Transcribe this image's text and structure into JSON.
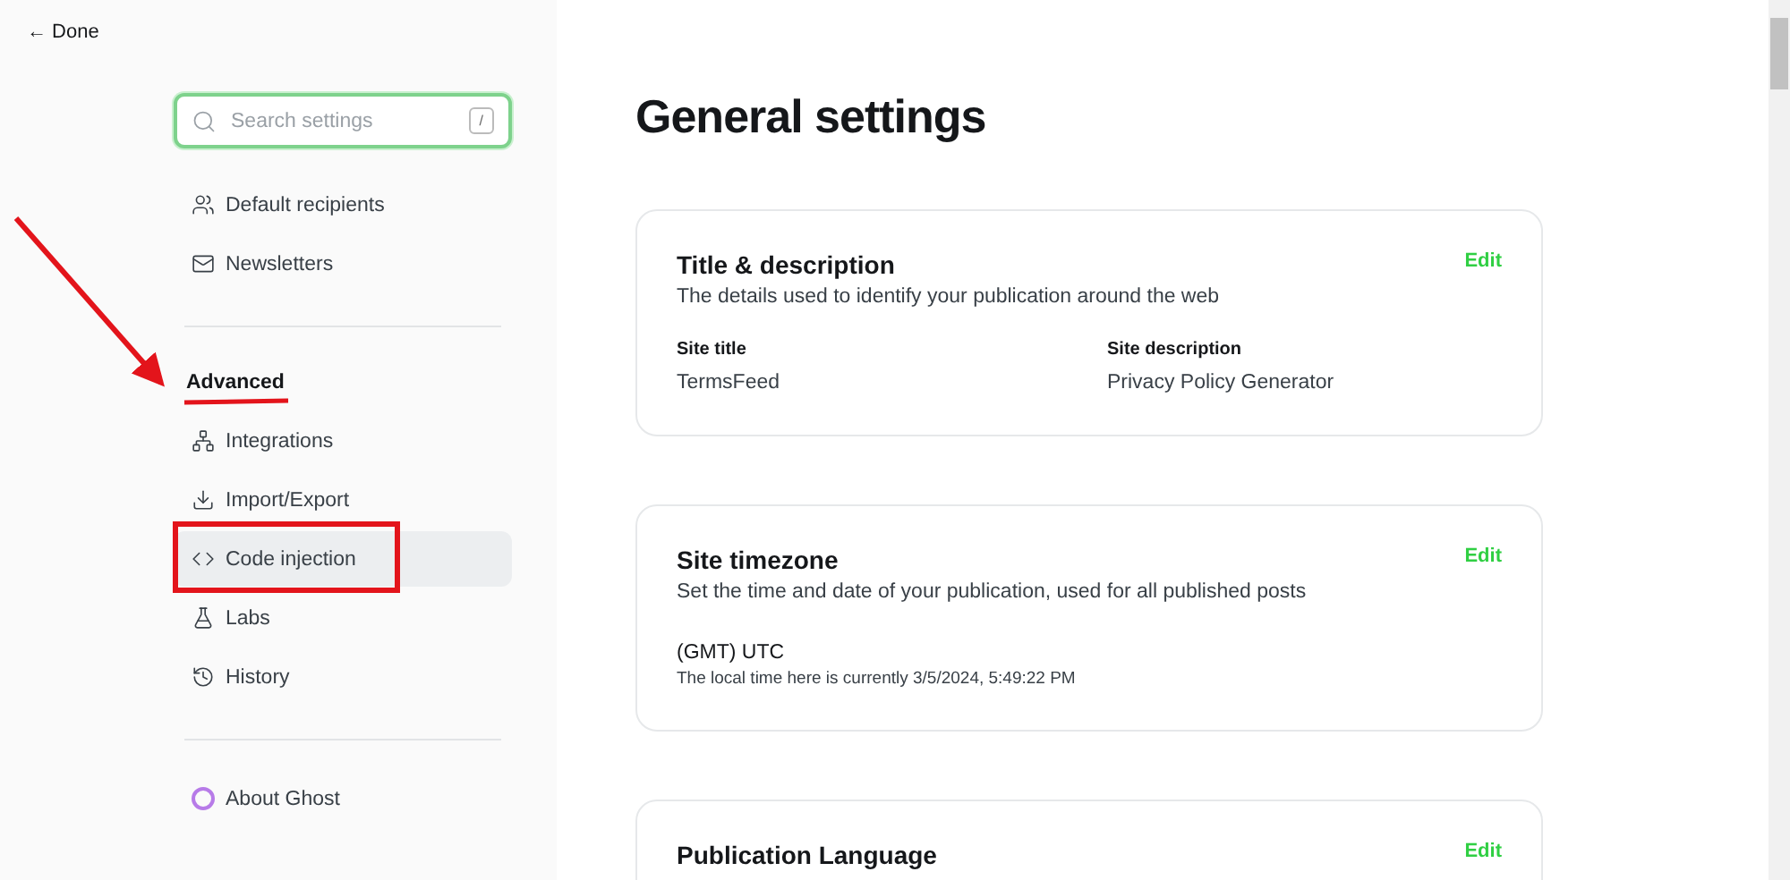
{
  "back_link": {
    "label": "← Done"
  },
  "search": {
    "placeholder": "Search settings",
    "shortcut": "/"
  },
  "sidebar": {
    "groups": [
      {
        "items": [
          {
            "label": "Default recipients",
            "selected": false
          },
          {
            "label": "Newsletters",
            "selected": false
          }
        ]
      },
      {
        "heading": "Advanced",
        "items": [
          {
            "label": "Integrations",
            "selected": false
          },
          {
            "label": "Import/Export",
            "selected": false
          },
          {
            "label": "Code injection",
            "selected": true
          },
          {
            "label": "Labs",
            "selected": false
          },
          {
            "label": "History",
            "selected": false
          }
        ]
      },
      {
        "items": [
          {
            "label": "About Ghost",
            "selected": false
          }
        ]
      }
    ]
  },
  "page_title": "General settings",
  "sections": [
    {
      "title": "Title & description",
      "description": "The details used to identify your publication around the web",
      "edit": "Edit",
      "fields": [
        {
          "label": "Site title",
          "value": "TermsFeed"
        },
        {
          "label": "Site description",
          "value": "Privacy Policy Generator"
        }
      ]
    },
    {
      "title": "Site timezone",
      "description": "Set the time and date of your publication, used for all published posts",
      "edit": "Edit",
      "value": "(GMT) UTC",
      "note": "The local time here is currently 3/5/2024, 5:49:22 PM"
    },
    {
      "title": "Publication Language",
      "edit": "Edit"
    }
  ]
}
